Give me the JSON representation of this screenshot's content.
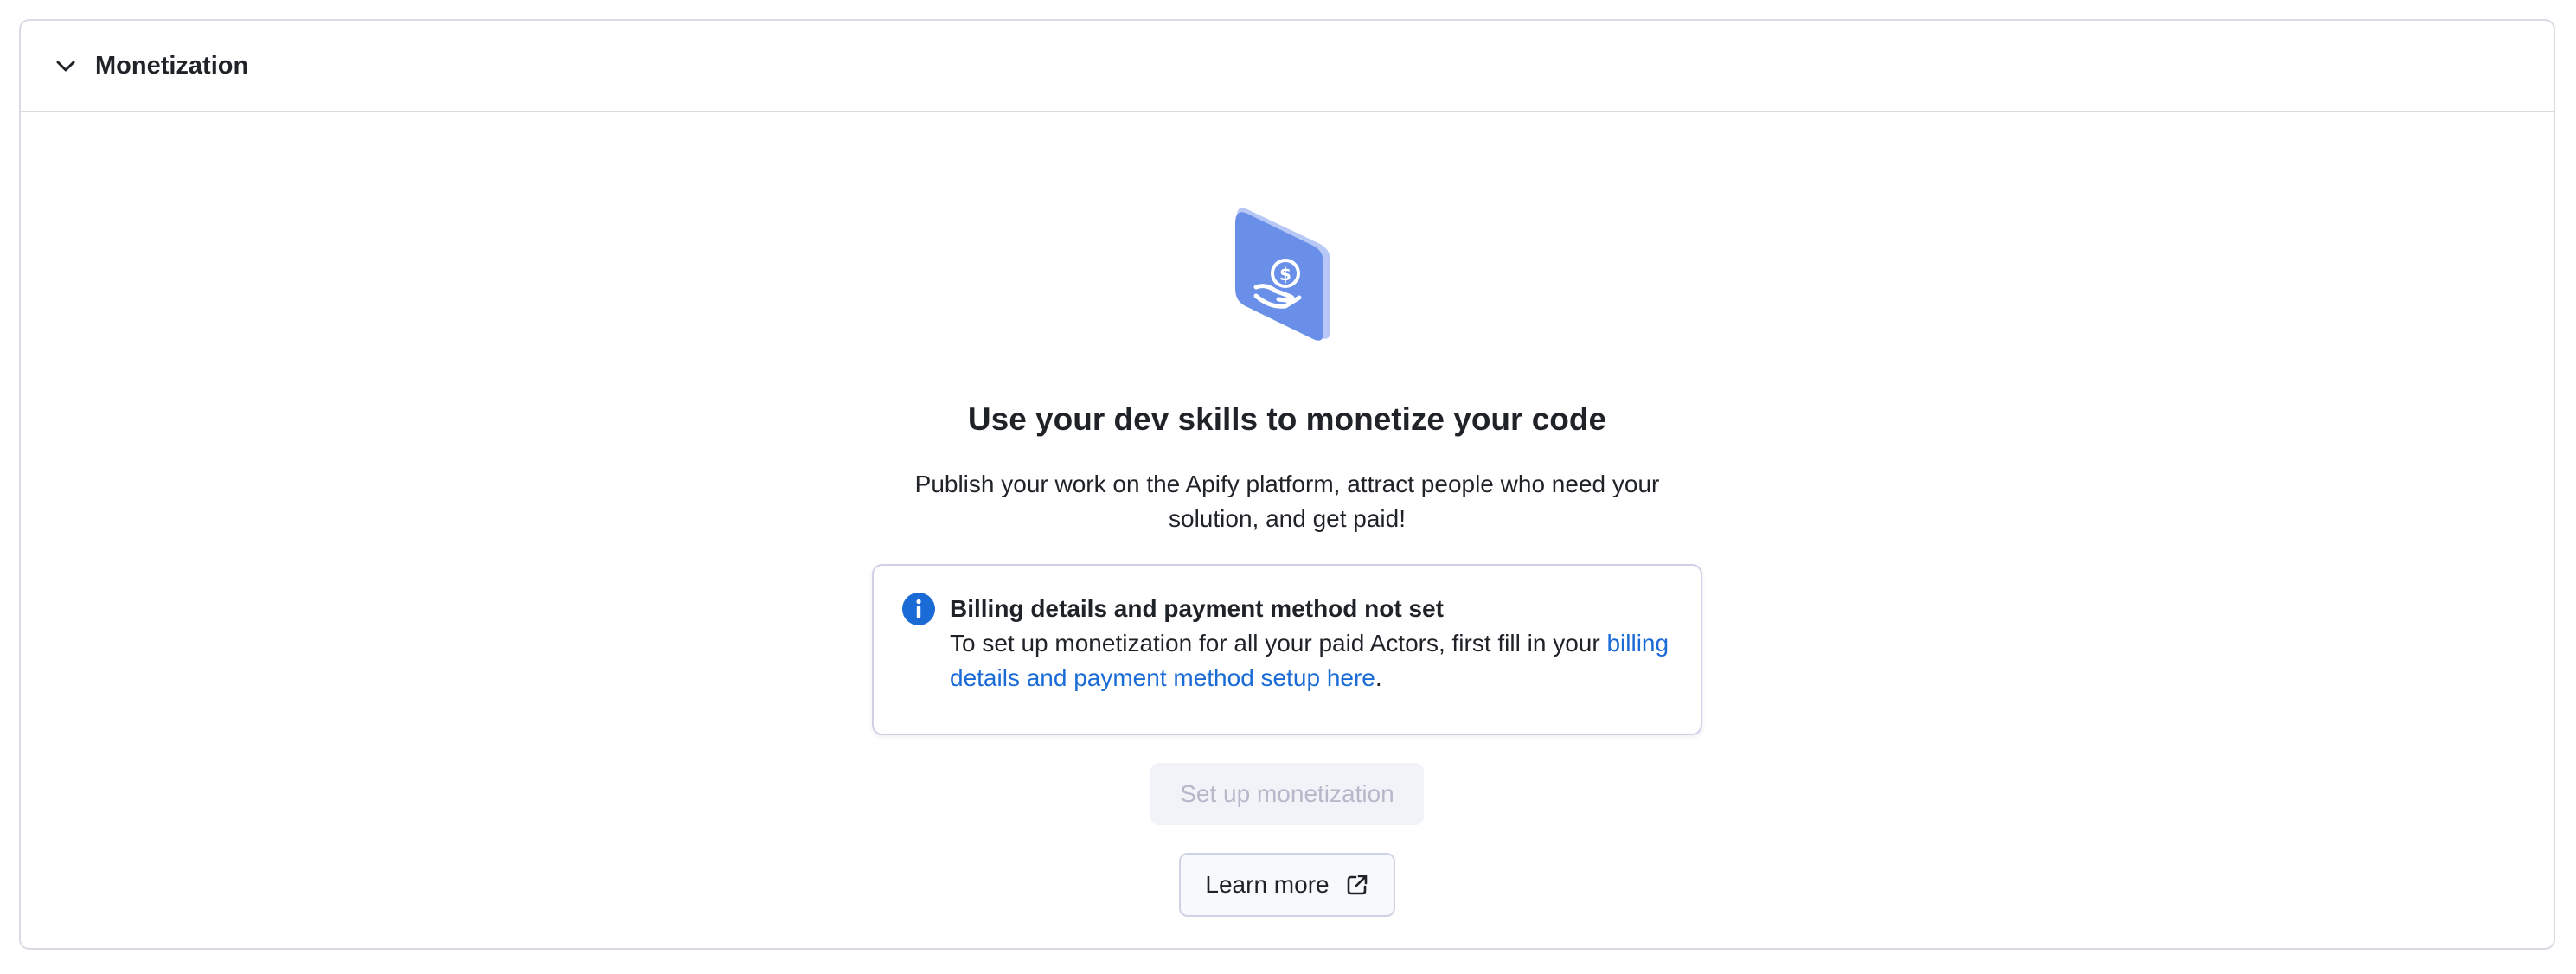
{
  "section": {
    "title": "Monetization",
    "collapse_icon": "chevron-down-icon"
  },
  "empty_state": {
    "illustration_icon": "hand-money-icon",
    "headline": "Use your dev skills to monetize your code",
    "description": "Publish your work on the Apify platform, attract people who need your solution, and get paid!"
  },
  "alert": {
    "icon": "info-icon",
    "title": "Billing details and payment method not set",
    "text_before_link": "To set up monetization for all your paid Actors, first fill in your ",
    "link_text": "billing details and payment method setup here",
    "text_after_link": "."
  },
  "actions": {
    "primary_label": "Set up monetization",
    "secondary_label": "Learn more",
    "secondary_icon": "external-link-icon"
  },
  "colors": {
    "accent": "#1a6bd6",
    "illustration_blue": "#6a8fe8",
    "info_blue": "#1a6bd6",
    "border": "#d9dbe3"
  }
}
